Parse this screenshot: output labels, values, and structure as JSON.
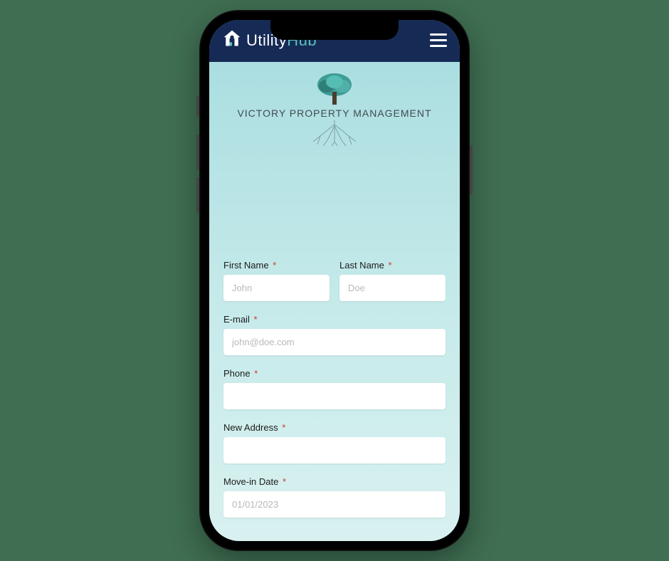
{
  "header": {
    "brand_utility": "Utility",
    "brand_hub": "Hub"
  },
  "company": {
    "name": "VICTORY PROPERTY MANAGEMENT"
  },
  "form": {
    "first_name": {
      "label": "First Name",
      "placeholder": "John",
      "value": ""
    },
    "last_name": {
      "label": "Last Name",
      "placeholder": "Doe",
      "value": ""
    },
    "email": {
      "label": "E-mail",
      "placeholder": "john@doe.com",
      "value": ""
    },
    "phone": {
      "label": "Phone",
      "placeholder": "",
      "value": ""
    },
    "address": {
      "label": "New Address",
      "placeholder": "",
      "value": ""
    },
    "movein": {
      "label": "Move-in Date",
      "placeholder": "01/01/2023",
      "value": ""
    }
  },
  "required_marker": "*"
}
